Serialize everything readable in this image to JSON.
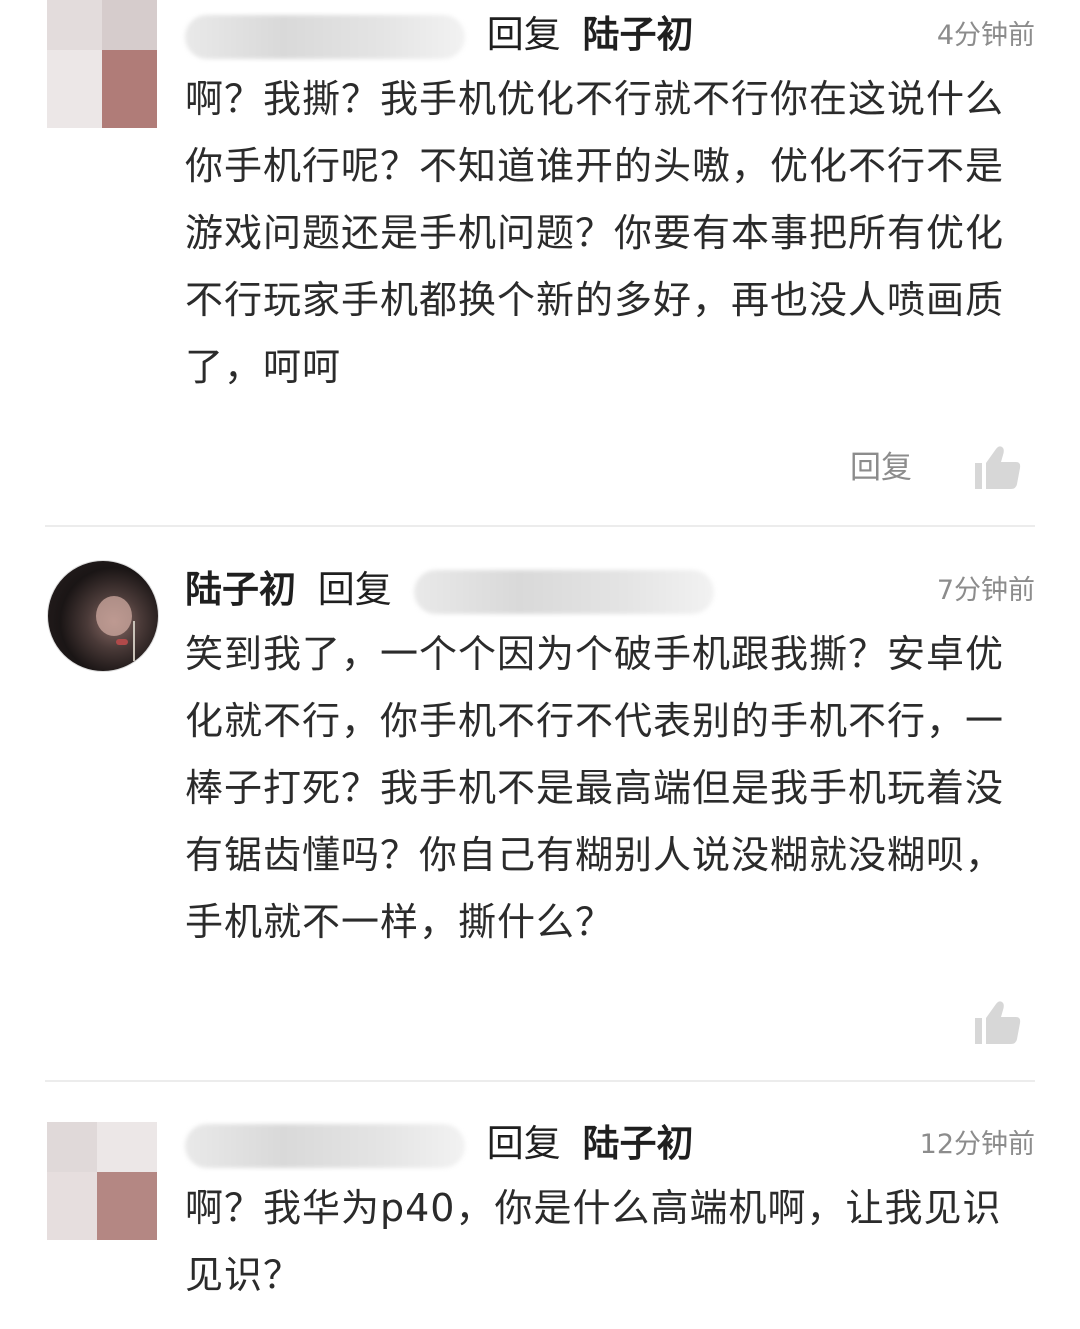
{
  "comments": [
    {
      "author": "",
      "reply_word": "回复",
      "reply_to": "陆子初",
      "time": "4分钟前",
      "text": "啊？我撕？我手机优化不行就不行你在这说什么你手机行呢？不知道谁开的头嗷，优化不行不是游戏问题还是手机问题？你要有本事把所有优化不行玩家手机都换个新的多好，再也没人喷画质了，呵呵",
      "action_reply": "回复",
      "like_icon": "thumbs-up-icon"
    },
    {
      "author": "陆子初",
      "reply_word": "回复",
      "reply_to": "",
      "time": "7分钟前",
      "text": "笑到我了，一个个因为个破手机跟我撕？安卓优化就不行，你手机不行不代表别的手机不行，一棒子打死？我手机不是最高端但是我手机玩着没有锯齿懂吗？你自己有糊别人说没糊就没糊呗，手机就不一样，撕什么？",
      "like_icon": "thumbs-up-icon"
    },
    {
      "author": "",
      "reply_word": "回复",
      "reply_to": "陆子初",
      "time": "12分钟前",
      "text": "啊？我华为p40，你是什么高端机啊，让我见识见识？"
    }
  ],
  "colors": {
    "text": "#2b2b2b",
    "meta": "#8c8c8c",
    "divider": "#ececec"
  }
}
